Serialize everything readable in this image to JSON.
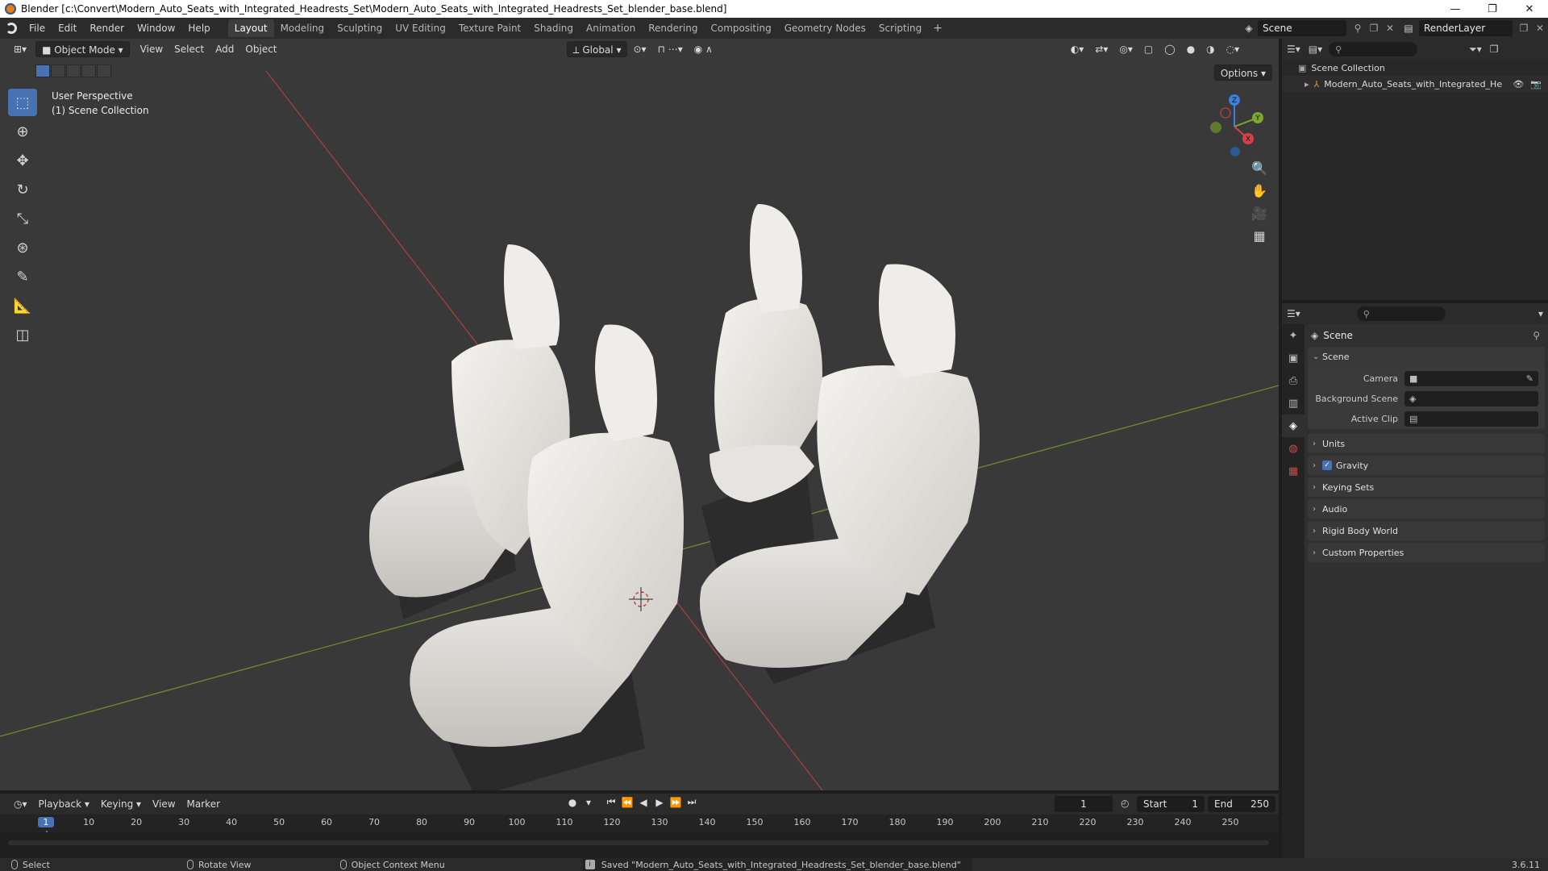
{
  "window": {
    "title": "Blender [c:\\Convert\\Modern_Auto_Seats_with_Integrated_Headrests_Set\\Modern_Auto_Seats_with_Integrated_Headrests_Set_blender_base.blend]",
    "minimize": "—",
    "maximize": "❐",
    "close": "✕"
  },
  "menu": [
    "File",
    "Edit",
    "Render",
    "Window",
    "Help"
  ],
  "workspaces": [
    "Layout",
    "Modeling",
    "Sculpting",
    "UV Editing",
    "Texture Paint",
    "Shading",
    "Animation",
    "Rendering",
    "Compositing",
    "Geometry Nodes",
    "Scripting"
  ],
  "active_workspace": "Layout",
  "add_workspace": "+",
  "scene_name": "Scene",
  "render_layer": "RenderLayer",
  "viewport": {
    "mode": "Object Mode",
    "menus": [
      "View",
      "Select",
      "Add",
      "Object"
    ],
    "orientation": "Global",
    "options": "Options",
    "info_line1": "User Perspective",
    "info_line2": "(1) Scene Collection",
    "gizmo": {
      "x": "X",
      "y": "Y",
      "z": "Z"
    }
  },
  "toolbar_icons": [
    "select-box-icon",
    "cursor-icon",
    "move-icon",
    "rotate-icon",
    "scale-icon",
    "transform-icon",
    "annotate-icon",
    "measure-icon",
    "add-cube-icon"
  ],
  "outliner": {
    "collection": "Scene Collection",
    "object": "Modern_Auto_Seats_with_Integrated_He"
  },
  "properties": {
    "title": "Scene",
    "section": "Scene",
    "camera_label": "Camera",
    "background_scene_label": "Background Scene",
    "active_clip_label": "Active Clip",
    "sections": [
      "Units",
      "Gravity",
      "Keying Sets",
      "Audio",
      "Rigid Body World",
      "Custom Properties"
    ],
    "gravity_checked": "✓"
  },
  "timeline": {
    "menus": [
      "Playback",
      "Keying",
      "View",
      "Marker"
    ],
    "current_frame": "1",
    "start_label": "Start",
    "start": "1",
    "end_label": "End",
    "end": "250",
    "ticks": [
      "1",
      "10",
      "20",
      "30",
      "40",
      "50",
      "60",
      "70",
      "80",
      "90",
      "100",
      "110",
      "120",
      "130",
      "140",
      "150",
      "160",
      "170",
      "180",
      "190",
      "200",
      "210",
      "220",
      "230",
      "240",
      "250"
    ]
  },
  "status": {
    "select": "Select",
    "rotate": "Rotate View",
    "context": "Object Context Menu",
    "message": "Saved \"Modern_Auto_Seats_with_Integrated_Headrests_Set_blender_base.blend\"",
    "version": "3.6.11"
  }
}
